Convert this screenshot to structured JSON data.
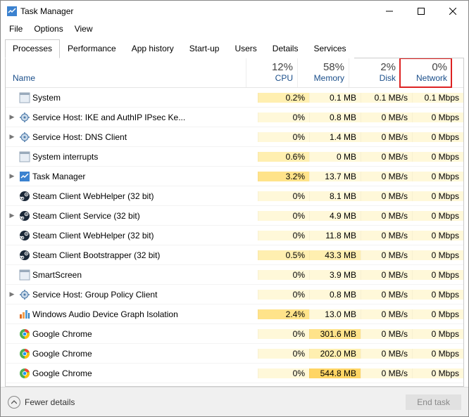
{
  "window": {
    "title": "Task Manager"
  },
  "menu": [
    "File",
    "Options",
    "View"
  ],
  "tabs": [
    "Processes",
    "Performance",
    "App history",
    "Start-up",
    "Users",
    "Details",
    "Services"
  ],
  "activeTab": 0,
  "columns": {
    "name": "Name",
    "metrics": [
      {
        "pct": "12%",
        "label": "CPU"
      },
      {
        "pct": "58%",
        "label": "Memory"
      },
      {
        "pct": "2%",
        "label": "Disk"
      },
      {
        "pct": "0%",
        "label": "Network"
      }
    ]
  },
  "rows": [
    {
      "exp": "",
      "icon": "system",
      "name": "System",
      "cpu": "0.2%",
      "cpuH": 2,
      "mem": "0.1 MB",
      "memH": 1,
      "disk": "0.1 MB/s",
      "diskH": 1,
      "net": "0.1 Mbps",
      "netH": 1
    },
    {
      "exp": ">",
      "icon": "gear",
      "name": "Service Host: IKE and AuthIP IPsec Ke...",
      "cpu": "0%",
      "cpuH": 1,
      "mem": "0.8 MB",
      "memH": 1,
      "disk": "0 MB/s",
      "diskH": 1,
      "net": "0 Mbps",
      "netH": 1
    },
    {
      "exp": ">",
      "icon": "gear",
      "name": "Service Host: DNS Client",
      "cpu": "0%",
      "cpuH": 1,
      "mem": "1.4 MB",
      "memH": 1,
      "disk": "0 MB/s",
      "diskH": 1,
      "net": "0 Mbps",
      "netH": 1
    },
    {
      "exp": "",
      "icon": "system",
      "name": "System interrupts",
      "cpu": "0.6%",
      "cpuH": 2,
      "mem": "0 MB",
      "memH": 1,
      "disk": "0 MB/s",
      "diskH": 1,
      "net": "0 Mbps",
      "netH": 1
    },
    {
      "exp": ">",
      "icon": "taskmgr",
      "name": "Task Manager",
      "cpu": "3.2%",
      "cpuH": 3,
      "mem": "13.7 MB",
      "memH": 1,
      "disk": "0 MB/s",
      "diskH": 1,
      "net": "0 Mbps",
      "netH": 1
    },
    {
      "exp": "",
      "icon": "steam",
      "name": "Steam Client WebHelper (32 bit)",
      "cpu": "0%",
      "cpuH": 1,
      "mem": "8.1 MB",
      "memH": 1,
      "disk": "0 MB/s",
      "diskH": 1,
      "net": "0 Mbps",
      "netH": 1
    },
    {
      "exp": ">",
      "icon": "steam",
      "name": "Steam Client Service (32 bit)",
      "cpu": "0%",
      "cpuH": 1,
      "mem": "4.9 MB",
      "memH": 1,
      "disk": "0 MB/s",
      "diskH": 1,
      "net": "0 Mbps",
      "netH": 1
    },
    {
      "exp": "",
      "icon": "steam",
      "name": "Steam Client WebHelper (32 bit)",
      "cpu": "0%",
      "cpuH": 1,
      "mem": "11.8 MB",
      "memH": 1,
      "disk": "0 MB/s",
      "diskH": 1,
      "net": "0 Mbps",
      "netH": 1
    },
    {
      "exp": "",
      "icon": "steam",
      "name": "Steam Client Bootstrapper (32 bit)",
      "cpu": "0.5%",
      "cpuH": 2,
      "mem": "43.3 MB",
      "memH": 2,
      "disk": "0 MB/s",
      "diskH": 1,
      "net": "0 Mbps",
      "netH": 1
    },
    {
      "exp": "",
      "icon": "system",
      "name": "SmartScreen",
      "cpu": "0%",
      "cpuH": 1,
      "mem": "3.9 MB",
      "memH": 1,
      "disk": "0 MB/s",
      "diskH": 1,
      "net": "0 Mbps",
      "netH": 1
    },
    {
      "exp": ">",
      "icon": "gear",
      "name": "Service Host: Group Policy Client",
      "cpu": "0%",
      "cpuH": 1,
      "mem": "0.8 MB",
      "memH": 1,
      "disk": "0 MB/s",
      "diskH": 1,
      "net": "0 Mbps",
      "netH": 1
    },
    {
      "exp": "",
      "icon": "audio",
      "name": "Windows Audio Device Graph Isolation",
      "cpu": "2.4%",
      "cpuH": 3,
      "mem": "13.0 MB",
      "memH": 1,
      "disk": "0 MB/s",
      "diskH": 1,
      "net": "0 Mbps",
      "netH": 1
    },
    {
      "exp": "",
      "icon": "chrome",
      "name": "Google Chrome",
      "cpu": "0%",
      "cpuH": 1,
      "mem": "301.6 MB",
      "memH": 3,
      "disk": "0 MB/s",
      "diskH": 1,
      "net": "0 Mbps",
      "netH": 1
    },
    {
      "exp": "",
      "icon": "chrome",
      "name": "Google Chrome",
      "cpu": "0%",
      "cpuH": 1,
      "mem": "202.0 MB",
      "memH": 2,
      "disk": "0 MB/s",
      "diskH": 1,
      "net": "0 Mbps",
      "netH": 1
    },
    {
      "exp": "",
      "icon": "chrome",
      "name": "Google Chrome",
      "cpu": "0%",
      "cpuH": 1,
      "mem": "544.8 MB",
      "memH": 4,
      "disk": "0 MB/s",
      "diskH": 1,
      "net": "0 Mbps",
      "netH": 1
    }
  ],
  "footer": {
    "fewer": "Fewer details",
    "endtask": "End task"
  }
}
